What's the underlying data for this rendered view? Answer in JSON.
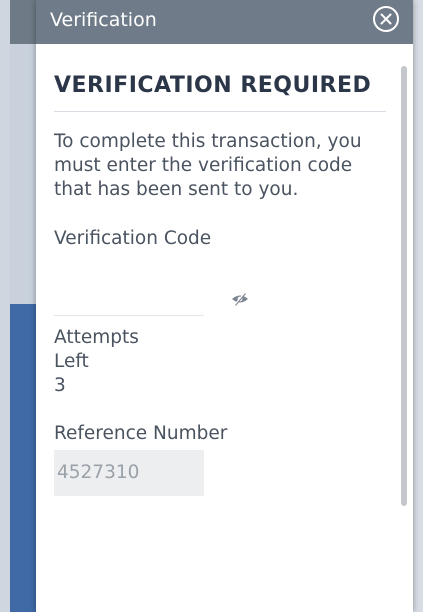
{
  "dialog": {
    "title": "Verification",
    "close_icon": "close-circle-icon"
  },
  "content": {
    "heading": "VERIFICATION REQUIRED",
    "instructions": "To complete this transaction, you must enter the verification code that has been sent to you.",
    "code_label": "Verification Code",
    "code_value": "",
    "visibility_icon": "eye-slash-icon",
    "attempts_label_line1": "Attempts",
    "attempts_label_line2": "Left",
    "attempts_left": "3",
    "reference_label": "Reference Number",
    "reference_value": "4527310"
  },
  "colors": {
    "header_bg": "#6f7b88",
    "heading_text": "#2b3648",
    "body_text": "#4a5360",
    "readonly_bg": "#eceeef"
  }
}
